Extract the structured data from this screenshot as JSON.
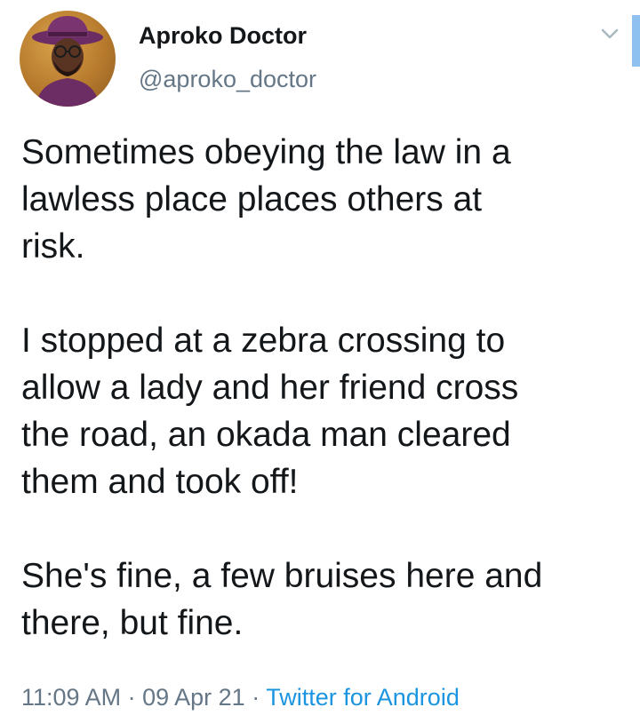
{
  "author": {
    "display_name": "Aproko Doctor",
    "handle": "@aproko_doctor",
    "avatar_icon": "profile-photo"
  },
  "menu_icon": "chevron-down-icon",
  "tweet": {
    "paragraphs": [
      "Sometimes obeying the law in a\nlawless place places others at\nrisk.",
      "I stopped at a zebra crossing to\nallow a lady and her friend cross\nthe road, an okada man cleared\nthem and took off!",
      "She's fine, a few bruises here and\nthere, but fine."
    ]
  },
  "meta": {
    "time": "11:09 AM",
    "separator": "·",
    "date": "09 Apr 21",
    "source": "Twitter for Android"
  },
  "colors": {
    "text": "#14171a",
    "secondary": "#657786",
    "link": "#1b95e0"
  }
}
